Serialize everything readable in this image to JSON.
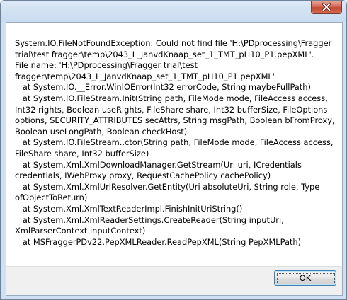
{
  "dialog": {
    "close_icon": "close-x-icon",
    "message_lines": [
      "System.IO.FileNotFoundException: Could not find file 'H:\\PDprocessing\\Fragger",
      "trial\\test fragger\\temp\\2043_L_JanvdKnaap_set_1_TMT_pH10_P1.pepXML'.",
      "File name: 'H:\\PDprocessing\\Fragger trial\\test",
      "fragger\\temp\\2043_L_JanvdKnaap_set_1_TMT_pH10_P1.pepXML'",
      "   at System.IO.__Error.WinIOError(Int32 errorCode, String maybeFullPath)",
      "   at System.IO.FileStream.Init(String path, FileMode mode, FileAccess access,",
      "Int32 rights, Boolean useRights, FileShare share, Int32 bufferSize, FileOptions",
      "options, SECURITY_ATTRIBUTES secAttrs, String msgPath, Boolean bFromProxy,",
      "Boolean useLongPath, Boolean checkHost)",
      "   at System.IO.FileStream..ctor(String path, FileMode mode, FileAccess access,",
      "FileShare share, Int32 bufferSize)",
      "   at System.Xml.XmlDownloadManager.GetStream(Uri uri, ICredentials",
      "credentials, IWebProxy proxy, RequestCachePolicy cachePolicy)",
      "   at System.Xml.XmlUrlResolver.GetEntity(Uri absoluteUri, String role, Type",
      "ofObjectToReturn)",
      "   at System.Xml.XmlTextReaderImpl.FinishInitUriString()",
      "   at System.Xml.XmlReaderSettings.CreateReader(String inputUri,",
      "XmlParserContext inputContext)",
      "   at MSFraggerPDv22.PepXMLReader.ReadPepXML(String PepXMLPath)"
    ],
    "ok_label": "OK"
  }
}
